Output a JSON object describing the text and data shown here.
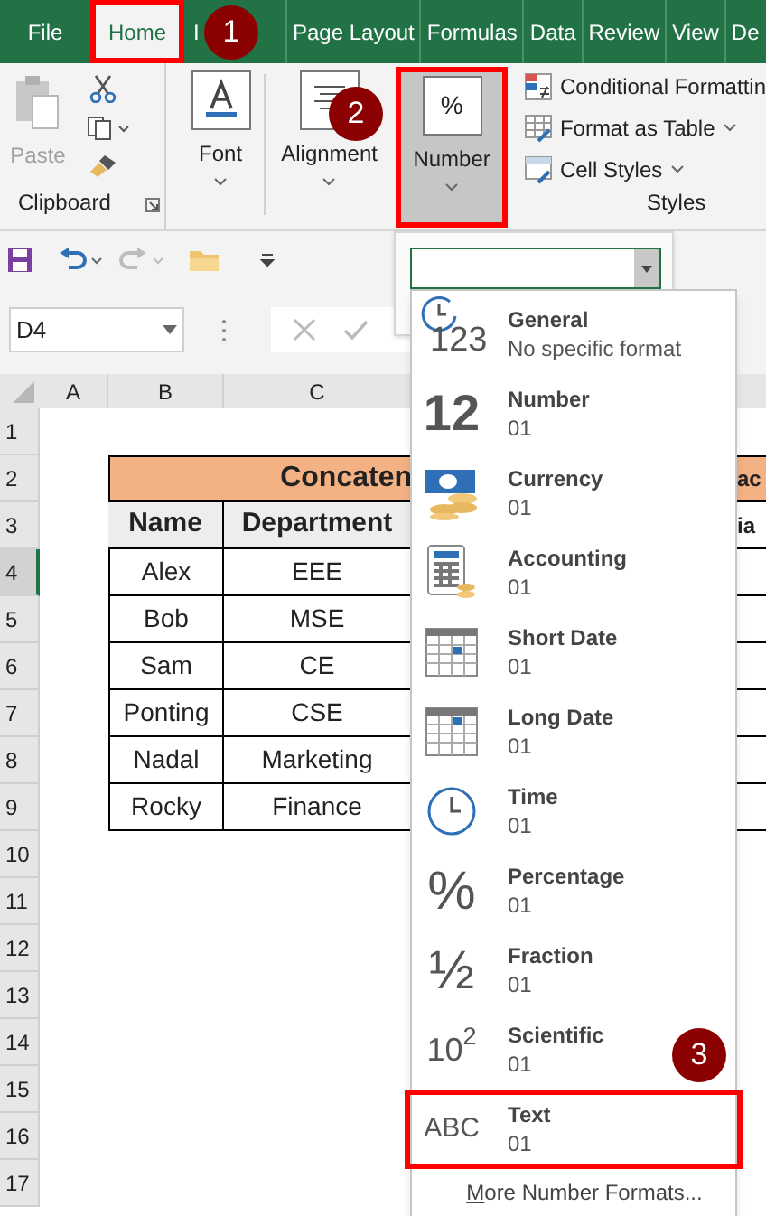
{
  "ribbon_tabs": [
    {
      "label": "File",
      "selected": false,
      "outlined": false
    },
    {
      "label": "Home",
      "selected": true,
      "outlined": true
    },
    {
      "label": "I",
      "selected": false,
      "outlined": false
    },
    {
      "label": "Page Layout",
      "selected": false,
      "outlined": false
    },
    {
      "label": "Formulas",
      "selected": false,
      "outlined": false
    },
    {
      "label": "Data",
      "selected": false,
      "outlined": false
    },
    {
      "label": "Review",
      "selected": false,
      "outlined": false
    },
    {
      "label": "View",
      "selected": false,
      "outlined": false
    },
    {
      "label": "De",
      "selected": false,
      "outlined": false
    }
  ],
  "ribbon": {
    "clipboard": {
      "paste_label": "Paste",
      "paste_disabled": true,
      "group_label": "Clipboard"
    },
    "font": {
      "label": "Font"
    },
    "alignment": {
      "label": "Alignment"
    },
    "number": {
      "label": "Number",
      "icon_text": "%",
      "pressed": true,
      "outlined": true
    },
    "styles": {
      "items": [
        {
          "label": "Conditional Formattin",
          "has_caret": false
        },
        {
          "label": "Format as Table",
          "has_caret": true
        },
        {
          "label": "Cell Styles",
          "has_caret": true
        }
      ],
      "group_label": "Styles"
    }
  },
  "quick_access": {
    "redo_disabled": true
  },
  "name_box": "D4",
  "sheet": {
    "columns": [
      "A",
      "B",
      "C"
    ],
    "rows": [
      {
        "label": "1",
        "selected": false
      },
      {
        "label": "2",
        "selected": false
      },
      {
        "label": "3",
        "selected": false
      },
      {
        "label": "4",
        "selected": true
      },
      {
        "label": "5",
        "selected": false
      },
      {
        "label": "6",
        "selected": false
      },
      {
        "label": "7",
        "selected": false
      },
      {
        "label": "8",
        "selected": false
      },
      {
        "label": "9",
        "selected": false
      },
      {
        "label": "10",
        "selected": false
      },
      {
        "label": "11",
        "selected": false
      },
      {
        "label": "12",
        "selected": false
      },
      {
        "label": "13",
        "selected": false
      },
      {
        "label": "14",
        "selected": false
      },
      {
        "label": "15",
        "selected": false
      },
      {
        "label": "16",
        "selected": false
      },
      {
        "label": "17",
        "selected": false
      }
    ],
    "table": {
      "title": "Concaten",
      "title_right": "ac",
      "headers": [
        "Name",
        "Department"
      ],
      "header_right": "ia",
      "rows": [
        [
          "Alex",
          "EEE"
        ],
        [
          "Bob",
          "MSE"
        ],
        [
          "Sam",
          "CE"
        ],
        [
          "Ponting",
          "CSE"
        ],
        [
          "Nadal",
          "Marketing"
        ],
        [
          "Rocky",
          "Finance"
        ]
      ]
    }
  },
  "number_format_dropdown": {
    "items": [
      {
        "kind": "general",
        "icon_text": "123",
        "title": "General",
        "subtitle": "No specific format",
        "outlined": false
      },
      {
        "kind": "number",
        "icon_text": "12",
        "title": "Number",
        "subtitle": "01",
        "outlined": false
      },
      {
        "kind": "currency",
        "title": "Currency",
        "subtitle": "01",
        "outlined": false
      },
      {
        "kind": "accounting",
        "title": "Accounting",
        "subtitle": "01",
        "outlined": false
      },
      {
        "kind": "short_date",
        "title": "Short Date",
        "subtitle": "01",
        "outlined": false
      },
      {
        "kind": "long_date",
        "title": "Long Date",
        "subtitle": "01",
        "outlined": false
      },
      {
        "kind": "time",
        "title": "Time",
        "subtitle": "01",
        "outlined": false
      },
      {
        "kind": "percentage",
        "icon_text": "%",
        "title": "Percentage",
        "subtitle": "01",
        "outlined": false
      },
      {
        "kind": "fraction",
        "icon_text": "½",
        "title": "Fraction",
        "subtitle": "01",
        "outlined": false
      },
      {
        "kind": "scientific",
        "icon_text": "10$^{2}$",
        "title": "Scientific",
        "subtitle": "01",
        "outlined": false
      },
      {
        "kind": "text",
        "icon_text": "ABC",
        "title": "Text",
        "subtitle": "01",
        "outlined": true
      }
    ],
    "more_label": "More Number Formats...",
    "more_underline_first": true
  },
  "annotations": [
    "1",
    "2",
    "3"
  ]
}
